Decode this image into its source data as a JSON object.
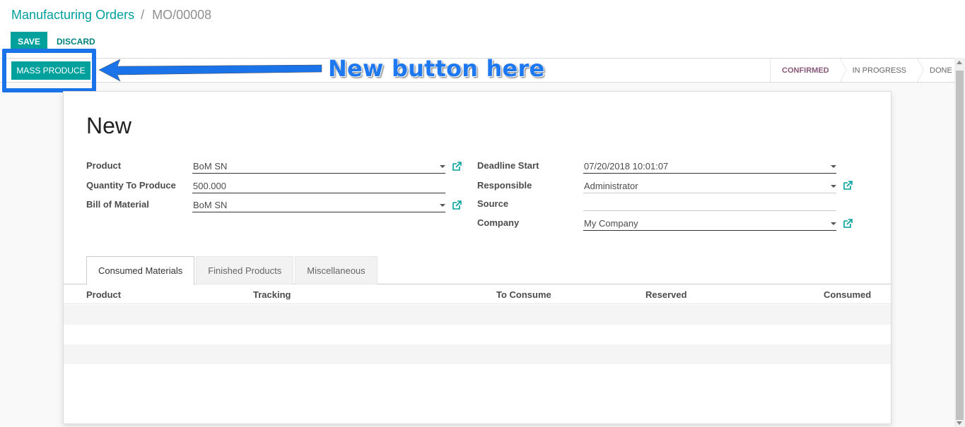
{
  "breadcrumb": {
    "parent": "Manufacturing Orders",
    "separator": "/",
    "current": "MO/00008"
  },
  "toolbar": {
    "save_label": "SAVE",
    "discard_label": "DISCARD"
  },
  "header": {
    "mass_produce_label": "MASS PRODUCE",
    "stages": [
      "CONFIRMED",
      "IN PROGRESS",
      "DONE"
    ],
    "active_stage": "CONFIRMED"
  },
  "annotation": {
    "callout": "New button here",
    "color": "#1e78f0"
  },
  "form": {
    "title": "New",
    "left": {
      "product_label": "Product",
      "product_value": "BoM SN",
      "qty_label": "Quantity To Produce",
      "qty_value": "500.000",
      "bom_label": "Bill of Material",
      "bom_value": "BoM SN"
    },
    "right": {
      "deadline_label": "Deadline Start",
      "deadline_value": "07/20/2018 10:01:07",
      "responsible_label": "Responsible",
      "responsible_value": "Administrator",
      "source_label": "Source",
      "source_value": "",
      "company_label": "Company",
      "company_value": "My Company"
    }
  },
  "tabs": [
    "Consumed Materials",
    "Finished Products",
    "Miscellaneous"
  ],
  "table": {
    "columns": [
      "Product",
      "Tracking",
      "To Consume",
      "Reserved",
      "Consumed"
    ]
  },
  "colors": {
    "accent": "#00a09d",
    "active_stage": "#875a7b",
    "highlight": "#1a73e8"
  }
}
